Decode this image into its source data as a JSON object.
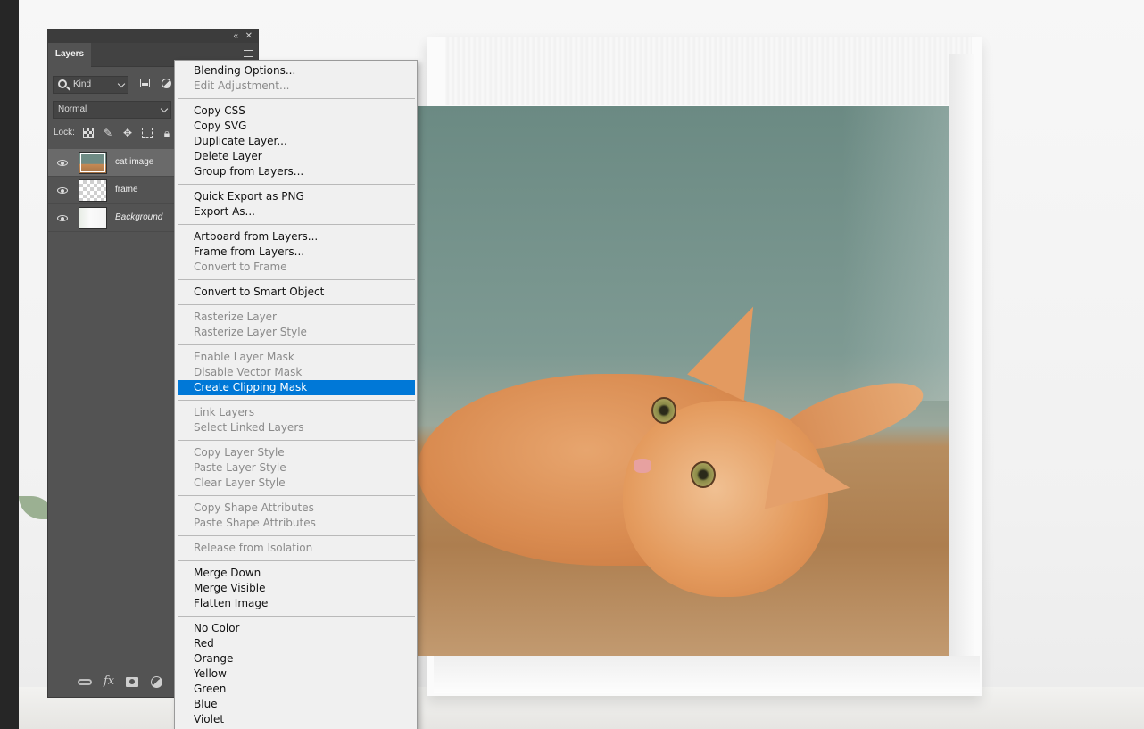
{
  "layers_panel": {
    "tab_label": "Layers",
    "filter": {
      "label": "Kind"
    },
    "blend_mode": "Normal",
    "lock_label": "Lock:",
    "layers": [
      {
        "name": "cat image",
        "visible": true,
        "selected": true,
        "thumbnail": "cat-photo",
        "italic": false
      },
      {
        "name": "frame",
        "visible": true,
        "selected": false,
        "thumbnail": "transparent",
        "italic": false
      },
      {
        "name": "Background",
        "visible": true,
        "selected": false,
        "thumbnail": "background",
        "italic": true
      }
    ],
    "bottom_icons": [
      "link-icon",
      "fx-icon",
      "mask-icon",
      "adjustment-icon"
    ]
  },
  "context_menu": {
    "highlight_color": "#0078d7",
    "items": [
      {
        "label": "Blending Options...",
        "disabled": false
      },
      {
        "label": "Edit Adjustment...",
        "disabled": true
      },
      {
        "separator": true
      },
      {
        "label": "Copy CSS",
        "disabled": false
      },
      {
        "label": "Copy SVG",
        "disabled": false
      },
      {
        "label": "Duplicate Layer...",
        "disabled": false
      },
      {
        "label": "Delete Layer",
        "disabled": false
      },
      {
        "label": "Group from Layers...",
        "disabled": false
      },
      {
        "separator": true
      },
      {
        "label": "Quick Export as PNG",
        "disabled": false
      },
      {
        "label": "Export As...",
        "disabled": false
      },
      {
        "separator": true
      },
      {
        "label": "Artboard from Layers...",
        "disabled": false
      },
      {
        "label": "Frame from Layers...",
        "disabled": false
      },
      {
        "label": "Convert to Frame",
        "disabled": true
      },
      {
        "separator": true
      },
      {
        "label": "Convert to Smart Object",
        "disabled": false
      },
      {
        "separator": true
      },
      {
        "label": "Rasterize Layer",
        "disabled": true
      },
      {
        "label": "Rasterize Layer Style",
        "disabled": true
      },
      {
        "separator": true
      },
      {
        "label": "Enable Layer Mask",
        "disabled": true
      },
      {
        "label": "Disable Vector Mask",
        "disabled": true
      },
      {
        "label": "Create Clipping Mask",
        "disabled": false,
        "highlighted": true
      },
      {
        "separator": true
      },
      {
        "label": "Link Layers",
        "disabled": true
      },
      {
        "label": "Select Linked Layers",
        "disabled": true
      },
      {
        "separator": true
      },
      {
        "label": "Copy Layer Style",
        "disabled": true
      },
      {
        "label": "Paste Layer Style",
        "disabled": true
      },
      {
        "label": "Clear Layer Style",
        "disabled": true
      },
      {
        "separator": true
      },
      {
        "label": "Copy Shape Attributes",
        "disabled": true
      },
      {
        "label": "Paste Shape Attributes",
        "disabled": true
      },
      {
        "separator": true
      },
      {
        "label": "Release from Isolation",
        "disabled": true
      },
      {
        "separator": true
      },
      {
        "label": "Merge Down",
        "disabled": false
      },
      {
        "label": "Merge Visible",
        "disabled": false
      },
      {
        "label": "Flatten Image",
        "disabled": false
      },
      {
        "separator": true
      },
      {
        "label": "No Color",
        "disabled": false
      },
      {
        "label": "Red",
        "disabled": false
      },
      {
        "label": "Orange",
        "disabled": false
      },
      {
        "label": "Yellow",
        "disabled": false
      },
      {
        "label": "Green",
        "disabled": false
      },
      {
        "label": "Blue",
        "disabled": false
      },
      {
        "label": "Violet",
        "disabled": false
      }
    ]
  }
}
